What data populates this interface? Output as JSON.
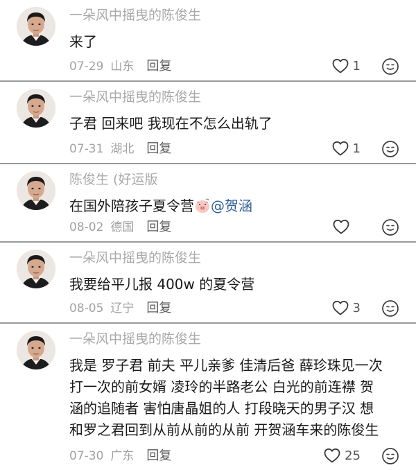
{
  "comments": [
    {
      "username": "一朵风中摇曳的陈俊生",
      "text": "来了",
      "date": "07-29",
      "location": "山东",
      "reply_label": "回复",
      "likes": "1"
    },
    {
      "username": "一朵风中摇曳的陈俊生",
      "text": "子君 回来吧 我现在不怎么出轨了",
      "date": "07-31",
      "location": "湖北",
      "reply_label": "回复",
      "likes": "1"
    },
    {
      "username": "陈俊生 (好运版",
      "text": "在国外陪孩子夏令营",
      "mention": "@贺涵",
      "date": "08-02",
      "location": "德国",
      "reply_label": "回复",
      "likes": ""
    },
    {
      "username": "一朵风中摇曳的陈俊生",
      "text": "我要给平儿报 400w 的夏令营",
      "date": "08-05",
      "location": "辽宁",
      "reply_label": "回复",
      "likes": "3"
    },
    {
      "username": "一朵风中摇曳的陈俊生",
      "text_lines": [
        "我是 罗子君 前夫 平儿亲爹 佳清后爸 薛珍珠见一次",
        "打一次的前女婿 凌玲的半路老公 白光的前连襟 贺",
        "涵的追随者 害怕唐晶姐的人 打段晓天的男子汉 想",
        "和罗之君回到从前从前的从前 开贺涵车来的陈俊生"
      ],
      "date": "07-30",
      "location": "广东",
      "reply_label": "回复",
      "likes": "25"
    }
  ],
  "icons": {
    "like": "heart-outline-icon",
    "emoji": "emoji-face-icon",
    "sticker": "piglet-sticker-icon"
  },
  "colors": {
    "username": "#a9a9a9",
    "text": "#1a1a1a",
    "meta": "#a2a2a2",
    "mention": "#2f5d99",
    "divider": "#9a9a9a"
  }
}
